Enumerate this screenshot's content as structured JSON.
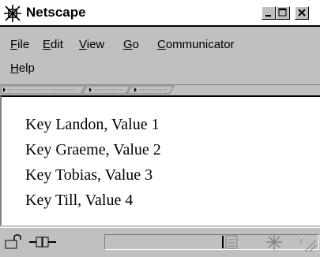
{
  "window": {
    "title": "Netscape",
    "icons": {
      "app": "netscape-icon",
      "minimize": "minimize-icon",
      "maximize": "maximize-icon",
      "close": "close-icon"
    }
  },
  "menu": {
    "file": {
      "label": "File",
      "accel": "F",
      "rest": "ile"
    },
    "edit": {
      "label": "Edit",
      "accel": "E",
      "rest": "dit"
    },
    "view": {
      "label": "View",
      "accel": "V",
      "rest": "iew"
    },
    "go": {
      "label": "Go",
      "accel": "G",
      "rest": "o"
    },
    "communicator": {
      "label": "Communicator",
      "accel": "C",
      "rest": "ommunicator"
    },
    "help": {
      "label": "Help",
      "accel": "H",
      "rest": "elp"
    }
  },
  "content": {
    "lines": [
      "Key Landon, Value 1",
      "Key Graeme, Value 2",
      "Key Tobias, Value 3",
      "Key Till, Value 4"
    ]
  },
  "status": {
    "icons": [
      "security-lock-icon",
      "connection-plug-icon",
      "component-bar-icon",
      "task-icon",
      "resize-grip-icon"
    ],
    "text": ""
  }
}
